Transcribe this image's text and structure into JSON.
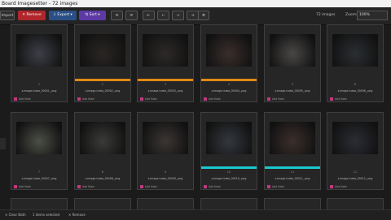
{
  "window": {
    "title": "Board Imagesetter - 72 images"
  },
  "toolbar": {
    "import_label": "Import",
    "remove_label": "✕ Remove",
    "export_label": "⇩ Export ▾",
    "sort_label": "⇅ Sort ▾",
    "btn_a": "⟲",
    "btn_b": "⟳",
    "btn_c": "⇤",
    "btn_d": "←",
    "btn_e": "→",
    "btn_f": "⇥",
    "gear_icon": "⚙",
    "image_count": "72 images",
    "zoom_label": "Zoom:",
    "zoom_value": "100%"
  },
  "cards": [
    {
      "num": "1",
      "file": "z-image-turbo_00001_.png",
      "notes": "Add Note",
      "bar": "",
      "thumb": "#3d3f47"
    },
    {
      "num": "2",
      "file": "z-image-turbo_00002_.png",
      "notes": "Add Note",
      "bar": "#e08a14",
      "thumb": "#2a2624"
    },
    {
      "num": "3",
      "file": "z-image-turbo_00003_.png",
      "notes": "Add Note",
      "bar": "#e08a14",
      "thumb": "#2d2a28"
    },
    {
      "num": "4",
      "file": "z-image-turbo_00004_.png",
      "notes": "Add Note",
      "bar": "#e08a14",
      "thumb": "#3a2e2c"
    },
    {
      "num": "5",
      "file": "z-image-turbo_00005_.png",
      "notes": "Add Note",
      "bar": "",
      "thumb": "#4a4746"
    },
    {
      "num": "6",
      "file": "z-image-turbo_00006_.png",
      "notes": "Add Note",
      "bar": "",
      "thumb": "#2b2e32"
    },
    {
      "num": "7",
      "file": "z-image-turbo_00007_.png",
      "notes": "Add Note",
      "bar": "",
      "thumb": "#4b4e46"
    },
    {
      "num": "8",
      "file": "z-image-turbo_00008_.png",
      "notes": "Add Note",
      "bar": "",
      "thumb": "#3a3a38"
    },
    {
      "num": "9",
      "file": "z-image-turbo_00009_.png",
      "notes": "Add Note",
      "bar": "",
      "thumb": "#3b3634"
    },
    {
      "num": "10",
      "file": "z-image-turbo_00010_.png",
      "notes": "Add Note",
      "bar": "#19c9cf",
      "thumb": "#34383e"
    },
    {
      "num": "11",
      "file": "z-image-turbo_00011_.png",
      "notes": "Add Note",
      "bar": "#19c9cf",
      "thumb": "#3b2f2c"
    },
    {
      "num": "12",
      "file": "z-image-turbo_00012_.png",
      "notes": "Add Note",
      "bar": "",
      "thumb": "#2b2d33"
    }
  ],
  "statusbar": {
    "clear": "✕ Clear Both",
    "selected": "1 items selected",
    "remove": "✕ Remove"
  }
}
